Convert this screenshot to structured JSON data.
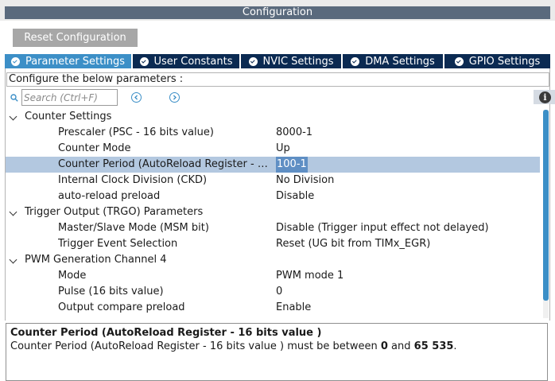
{
  "window": {
    "title": "Configuration"
  },
  "toolbar": {
    "reset_label": "Reset Configuration"
  },
  "tabs": [
    {
      "label": "Parameter Settings",
      "active": true
    },
    {
      "label": "User Constants",
      "active": false
    },
    {
      "label": "NVIC Settings",
      "active": false
    },
    {
      "label": "DMA Settings",
      "active": false
    },
    {
      "label": "GPIO Settings",
      "active": false
    }
  ],
  "panel": {
    "configure_label": "Configure the below parameters :",
    "search_placeholder": "Search (Ctrl+F)",
    "info_symbol": "i"
  },
  "tree": {
    "groups": [
      {
        "label": "Counter Settings",
        "params": [
          {
            "name": "Prescaler (PSC - 16 bits value)",
            "value": "8000-1"
          },
          {
            "name": "Counter Mode",
            "value": "Up"
          },
          {
            "name": "Counter Period (AutoReload Register - 1...",
            "value": "100-1",
            "selected": true
          },
          {
            "name": "Internal Clock Division (CKD)",
            "value": "No Division"
          },
          {
            "name": "auto-reload preload",
            "value": "Disable"
          }
        ]
      },
      {
        "label": "Trigger Output (TRGO) Parameters",
        "params": [
          {
            "name": "Master/Slave Mode (MSM bit)",
            "value": "Disable (Trigger input effect not delayed)"
          },
          {
            "name": "Trigger Event Selection",
            "value": "Reset (UG bit from TIMx_EGR)"
          }
        ]
      },
      {
        "label": "PWM Generation Channel 4",
        "params": [
          {
            "name": "Mode",
            "value": "PWM mode 1"
          },
          {
            "name": "Pulse (16 bits value)",
            "value": "0"
          },
          {
            "name": "Output compare preload",
            "value": "Enable"
          }
        ]
      }
    ]
  },
  "description": {
    "title": "Counter Period (AutoReload Register - 16 bits value )",
    "text_prefix": "Counter Period (AutoReload Register - 16 bits value ) must be between ",
    "min": "0",
    "text_mid": " and ",
    "max": "65 535",
    "text_suffix": "."
  },
  "colors": {
    "title_strip": "#5a6a7d",
    "tab_bar": "#0b2a52",
    "tab_active": "#3c8fc7",
    "selected_row": "#b3c8e0",
    "selected_value": "#5f8fc4"
  }
}
